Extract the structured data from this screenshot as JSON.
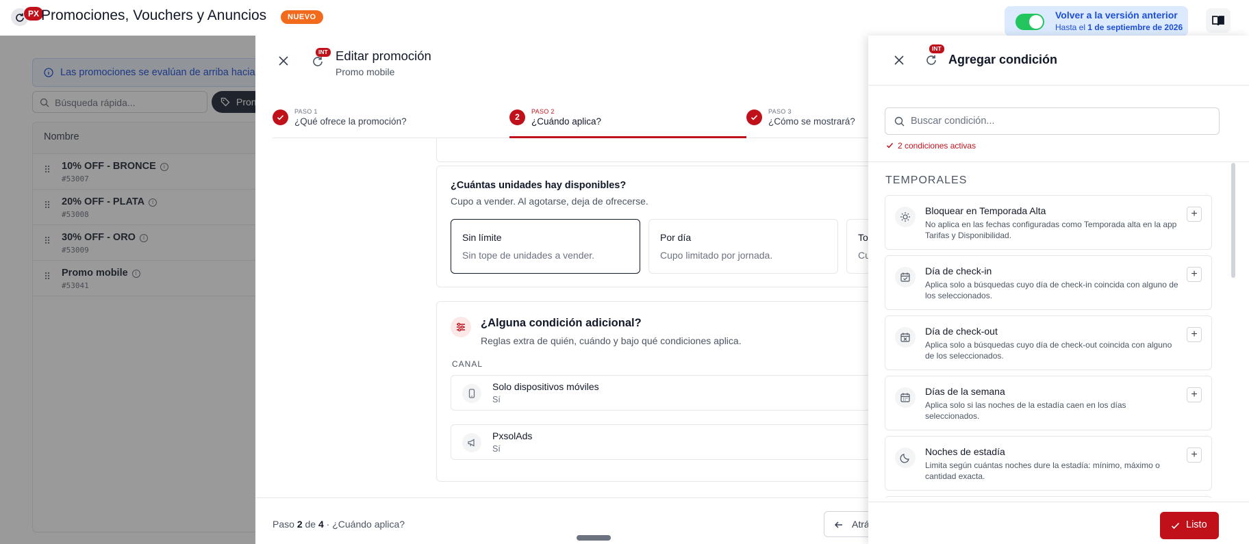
{
  "header": {
    "badge": "PX",
    "title": "Promociones, Vouchers y Anuncios",
    "new_badge": "NUEVO",
    "version_toggle_title": "Volver a la versión anterior",
    "version_toggle_sub_prefix": "Hasta el",
    "version_toggle_sub_date": "1 de septiembre de 2026",
    "toggle_on": true,
    "accent_color": "#c0101a"
  },
  "base_page": {
    "info_banner": "Las promociones se evalúan de arriba hacia",
    "search_placeholder": "Búsqueda rápida...",
    "filter_chip": "Pron",
    "table_header": "Nombre",
    "rows": [
      {
        "name": "10% OFF - BRONCE",
        "id": "#53007"
      },
      {
        "name": "20% OFF - PLATA",
        "id": "#53008"
      },
      {
        "name": "30% OFF - ORO",
        "id": "#53009"
      },
      {
        "name": "Promo mobile",
        "id": "#53041"
      }
    ]
  },
  "edit_drawer": {
    "int_badge": "INT",
    "title": "Editar promoción",
    "subtitle": "Promo mobile",
    "steps": [
      {
        "label": "PASO 1",
        "title": "¿Qué ofrece la promoción?",
        "state": "done"
      },
      {
        "label": "PASO 2",
        "number": "2",
        "title": "¿Cuándo aplica?",
        "state": "active"
      },
      {
        "label": "PASO 3",
        "title": "¿Cómo se mostrará?",
        "state": "done"
      }
    ],
    "units": {
      "title": "¿Cuántas unidades hay disponibles?",
      "subtitle": "Cupo a vender. Al agotarse, deja de ofrecerse.",
      "options": [
        {
          "title": "Sin límite",
          "desc": "Sin tope de unidades a vender.",
          "selected": true
        },
        {
          "title": "Por día",
          "desc": "Cupo limitado por jornada.",
          "selected": false
        },
        {
          "title": "To",
          "desc": "Cu",
          "selected": false
        }
      ]
    },
    "conditions": {
      "title": "¿Alguna condición adicional?",
      "subtitle": "Reglas extra de quién, cuándo y bajo qué condiciones aplica.",
      "section_label": "CANAL",
      "items": [
        {
          "name": "Solo dispositivos móviles",
          "value": "Sí"
        },
        {
          "name": "PxsolAds",
          "value": "Sí"
        }
      ]
    },
    "footer": {
      "step_prefix": "Paso",
      "step_current": "2",
      "step_of": "de",
      "step_total": "4",
      "step_name": "· ¿Cuándo aplica?",
      "back_label": "Atrá"
    }
  },
  "condition_panel": {
    "int_badge": "INT",
    "title": "Agregar condición",
    "search_placeholder": "Buscar condición...",
    "active_count_text": "2 condiciones activas",
    "section": "TEMPORALES",
    "items": [
      {
        "icon": "sun-icon",
        "name": "Bloquear en Temporada Alta",
        "desc": "No aplica en las fechas configuradas como Temporada alta en la app Tarifas y Disponibilidad."
      },
      {
        "icon": "calendar-check-icon",
        "name": "Día de check-in",
        "desc": "Aplica solo a búsquedas cuyo día de check-in coincida con alguno de los seleccionados."
      },
      {
        "icon": "calendar-x-icon",
        "name": "Día de check-out",
        "desc": "Aplica solo a búsquedas cuyo día de check-out coincida con alguno de los seleccionados."
      },
      {
        "icon": "calendar-icon",
        "name": "Días de la semana",
        "desc": "Aplica solo si las noches de la estadía caen en los días seleccionados."
      },
      {
        "icon": "moon-icon",
        "name": "Noches de estadía",
        "desc": "Limita según cuántas noches dure la estadía: mínimo, máximo o cantidad exacta."
      }
    ],
    "done_label": "Listo"
  }
}
